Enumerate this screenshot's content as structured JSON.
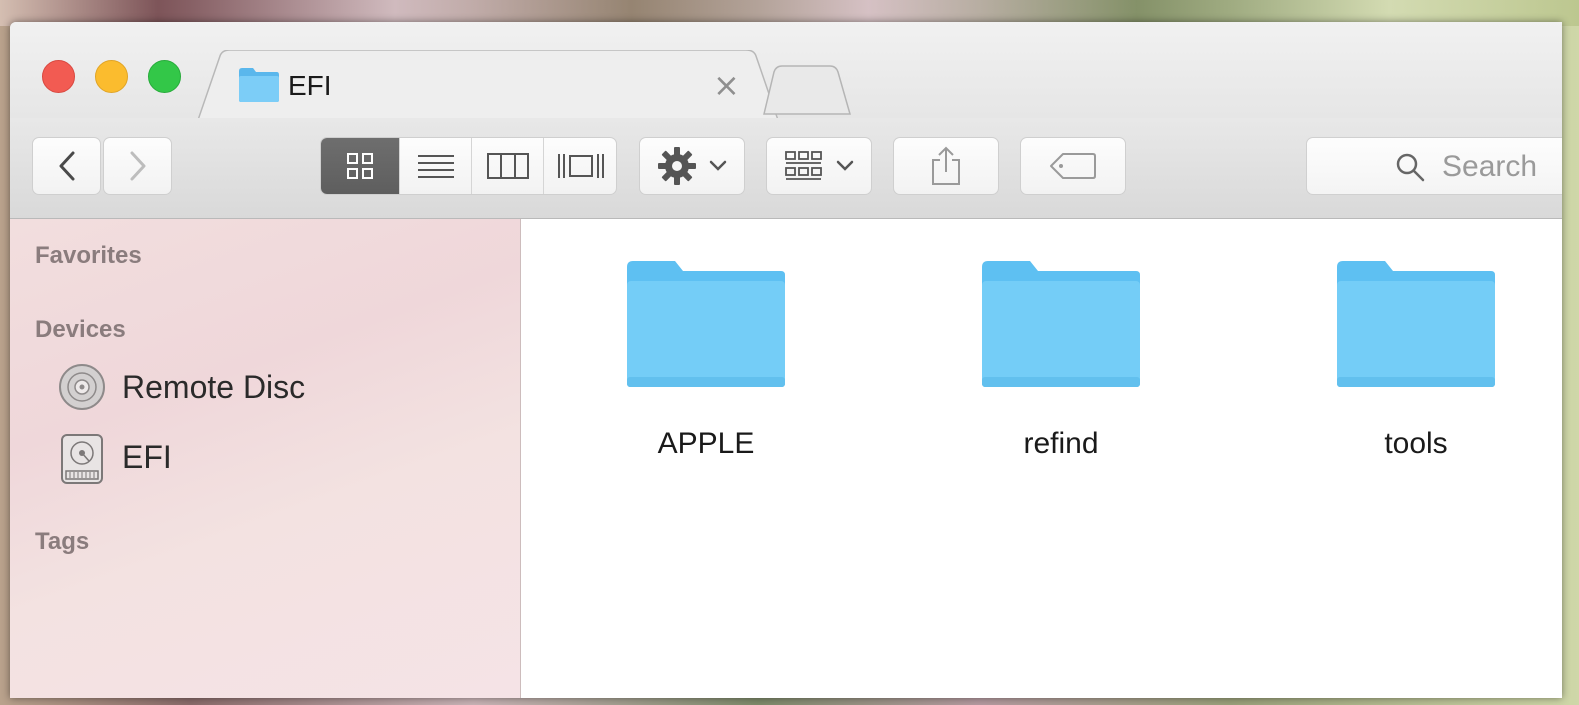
{
  "window": {
    "tab": {
      "title": "EFI",
      "icon": "folder-icon",
      "close_glyph": "×"
    }
  },
  "toolbar": {
    "back_icon": "chevron-left-icon",
    "forward_icon": "chevron-right-icon",
    "view_modes": [
      "icon-view",
      "list-view",
      "column-view",
      "cover-flow-view"
    ],
    "active_view": "icon-view",
    "action_icon": "gear-icon",
    "arrange_icon": "arrange-grid-icon",
    "share_icon": "share-icon",
    "tag_icon": "tag-icon",
    "search_placeholder": "Search"
  },
  "sidebar": {
    "sections": {
      "favorites": "Favorites",
      "devices": "Devices",
      "tags": "Tags"
    },
    "devices": [
      {
        "label": "Remote Disc",
        "icon": "remote-disc-icon"
      },
      {
        "label": "EFI",
        "icon": "hard-drive-icon"
      }
    ]
  },
  "content": {
    "items": [
      {
        "name": "APPLE",
        "type": "folder"
      },
      {
        "name": "refind",
        "type": "folder"
      },
      {
        "name": "tools",
        "type": "folder"
      }
    ]
  },
  "colors": {
    "folder": "#6cc8f5",
    "close": "#f25b52",
    "minimize": "#fbbc2e",
    "maximize": "#33c748",
    "sidebar_bg": "#f2dede",
    "active_segment": "#646464"
  }
}
